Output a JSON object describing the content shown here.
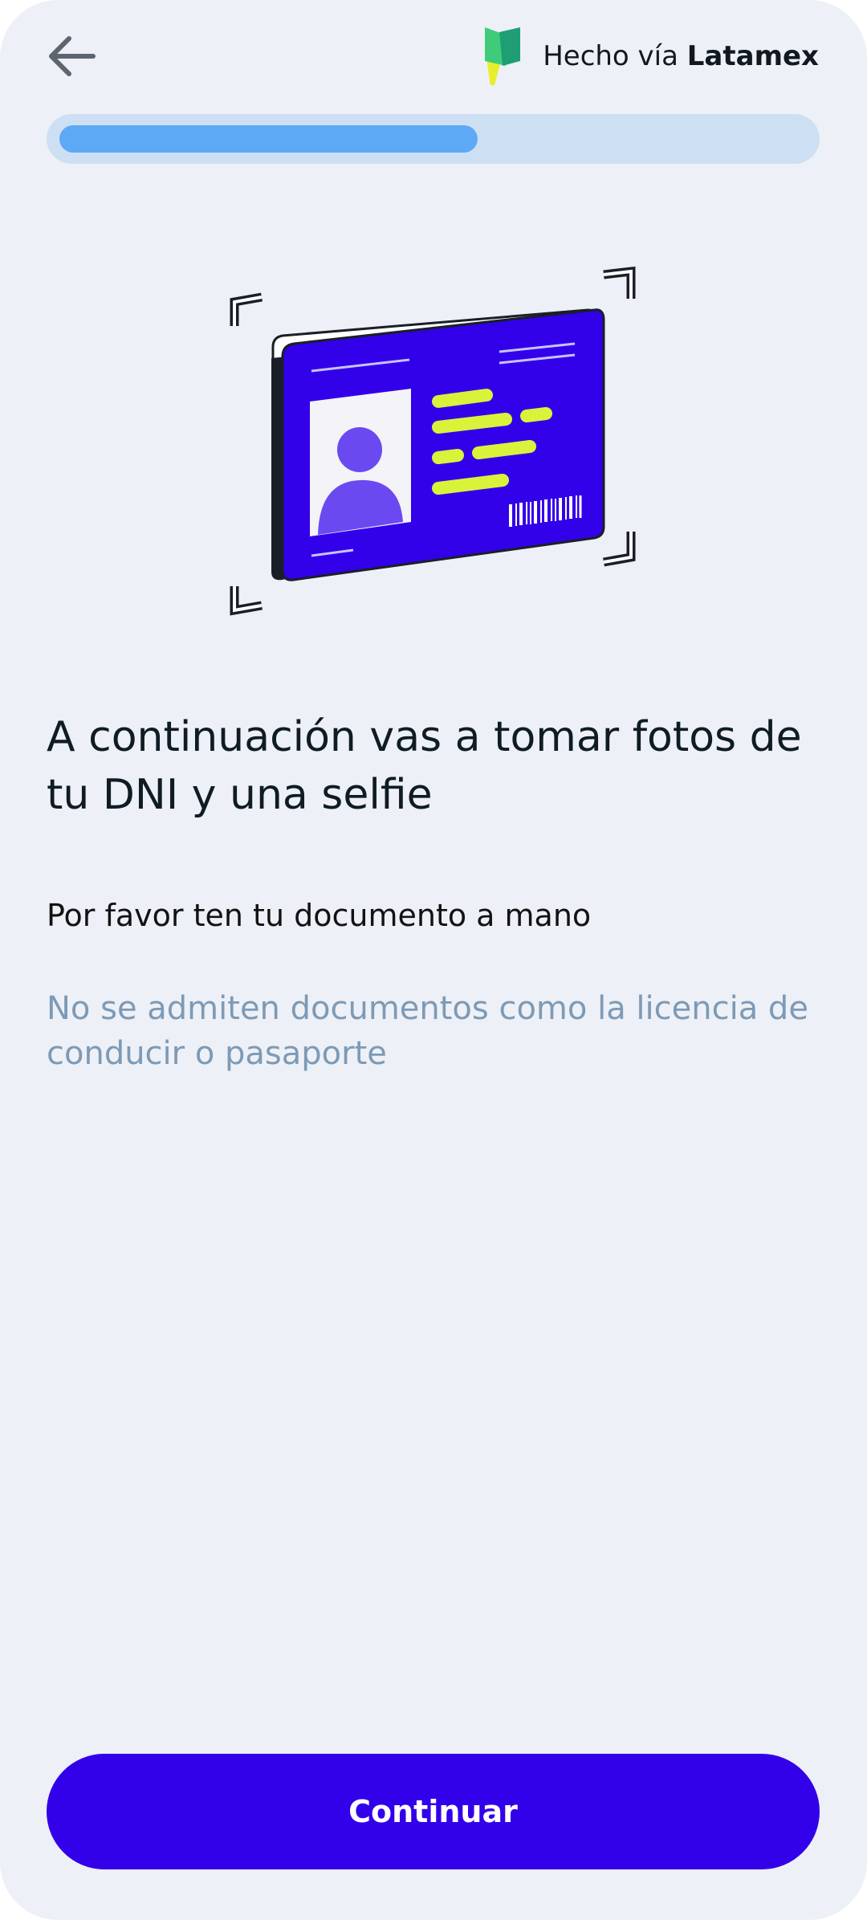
{
  "header": {
    "back_icon": "arrow-left-icon",
    "brand": {
      "prefix": "Hecho vía",
      "name": "Latamex",
      "logo_icon": "latamex-logo-icon"
    }
  },
  "progress": {
    "value": 0.56
  },
  "illustration": {
    "icon": "id-card-scan-icon"
  },
  "content": {
    "title": "A continuación vas a tomar fotos de tu DNI y una selfie",
    "subtitle": "Por favor ten tu documento a mano",
    "note": "No se admiten documentos como la licencia de conducir o pasaporte"
  },
  "footer": {
    "continue_label": "Continuar"
  },
  "colors": {
    "background": "#edf0f6",
    "primary": "#3300ea",
    "progress_track": "#cde0f3",
    "progress_fill": "#5ea9f6",
    "card_blue": "#3300ea",
    "card_yellow": "#d9f23a",
    "avatar_purple": "#6a4af0",
    "note_text": "#7d9ab6"
  }
}
